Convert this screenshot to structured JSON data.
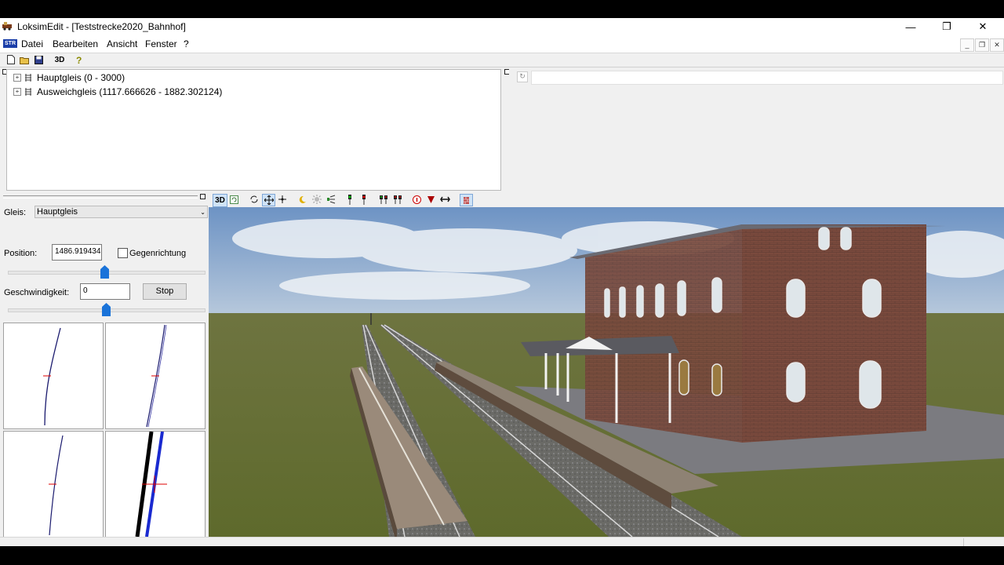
{
  "window": {
    "title": "LoksimEdit - [Teststrecke2020_Bahnhof]",
    "controls": {
      "minimize": "—",
      "maximize": "❐",
      "close": "✕"
    }
  },
  "menubar": {
    "logo": "STR",
    "items": [
      "Datei",
      "Bearbeiten",
      "Ansicht",
      "Fenster",
      "?"
    ]
  },
  "toolbar": {
    "items": [
      "new-file-icon",
      "open-folder-icon",
      "save-icon",
      "3D",
      "help-icon"
    ]
  },
  "tree": {
    "items": [
      {
        "label": "Hauptgleis (0 - 3000)"
      },
      {
        "label": "Ausweichgleis (1117.666626 - 1882.302124)"
      }
    ]
  },
  "controls": {
    "gleis_label": "Gleis:",
    "gleis_value": "Hauptgleis",
    "position_label": "Position:",
    "position_value": "1486.919434",
    "gegenrichtung_label": "Gegenrichtung",
    "gegenrichtung_checked": false,
    "speed_label": "Geschwindigkeit:",
    "speed_value": "0",
    "stop_label": "Stop"
  },
  "view3d_toolbar": {
    "label_3d": "3D"
  },
  "colors": {
    "sky_top": "#6d93c4",
    "ground": "#6c7336",
    "brick": "#7a4a3d",
    "accent_thumb": "#1a73d9"
  }
}
